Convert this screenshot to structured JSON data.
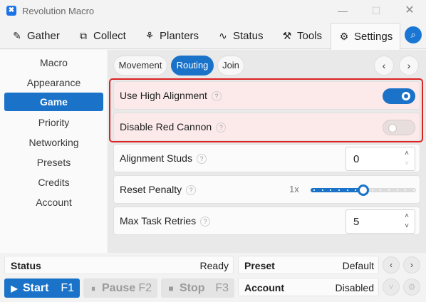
{
  "window": {
    "title": "Revolution Macro",
    "app_icon_glyph": "✖",
    "minimize": "—",
    "maximize": "☐",
    "close": "✕"
  },
  "tabs": [
    {
      "label": "Gather",
      "icon": "wand-icon",
      "glyph": "✎"
    },
    {
      "label": "Collect",
      "icon": "box-icon",
      "glyph": "⧉"
    },
    {
      "label": "Planters",
      "icon": "plant-icon",
      "glyph": "⚘"
    },
    {
      "label": "Status",
      "icon": "pulse-icon",
      "glyph": "∿"
    },
    {
      "label": "Tools",
      "icon": "wrench-icon",
      "glyph": "⚒"
    },
    {
      "label": "Settings",
      "icon": "gear-icon",
      "glyph": "⚙"
    }
  ],
  "search_glyph": "⌕",
  "sidebar": {
    "items": [
      "Macro",
      "Appearance",
      "Game",
      "Priority",
      "Networking",
      "Presets",
      "Credits",
      "Account"
    ],
    "active": "Game"
  },
  "subtabs": {
    "items": [
      "Movement",
      "Routing",
      "Join"
    ],
    "active": "Routing",
    "prev": "‹",
    "next": "›"
  },
  "settings": {
    "use_high_alignment": {
      "label": "Use High Alignment",
      "value": true
    },
    "disable_red_cannon": {
      "label": "Disable Red Cannon",
      "value": false
    },
    "alignment_studs": {
      "label": "Alignment Studs",
      "value": "0"
    },
    "reset_penalty": {
      "label": "Reset Penalty",
      "value_label": "1x",
      "level": 0.5
    },
    "max_task_retries": {
      "label": "Max Task Retries",
      "value": "5"
    },
    "help_glyph": "?",
    "up_glyph": "˄",
    "down_glyph": "˅"
  },
  "bottom": {
    "status_label": "Status",
    "status_value": "Ready",
    "start": {
      "label": "Start",
      "key": "F1",
      "glyph": "▶"
    },
    "pause": {
      "label": "Pause",
      "key": "F2",
      "glyph": "⏸"
    },
    "stop": {
      "label": "Stop",
      "key": "F3",
      "glyph": "■"
    },
    "preset_label": "Preset",
    "preset_value": "Default",
    "account_label": "Account",
    "account_value": "Disabled",
    "chevron_down": "˅",
    "settings_glyph": "⚙"
  },
  "colors": {
    "accent": "#1b73c9",
    "highlight_border": "#dd2222",
    "highlight_bg": "#fceaea"
  }
}
